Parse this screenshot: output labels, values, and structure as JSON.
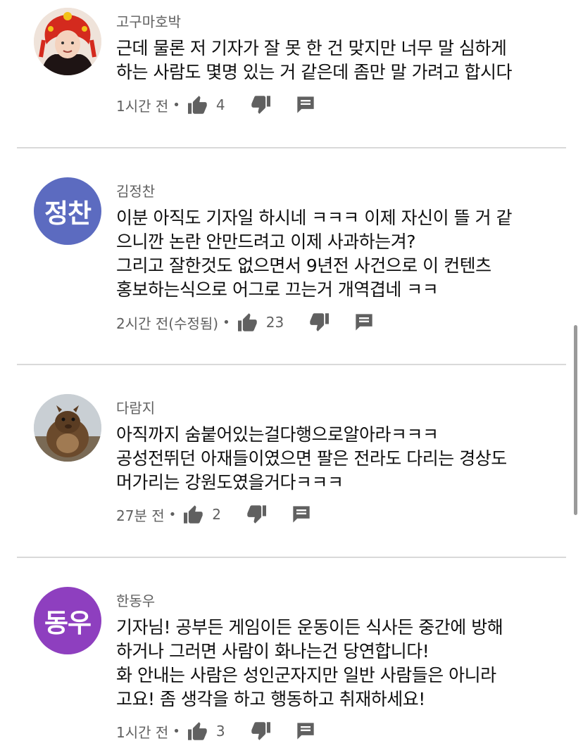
{
  "comments": [
    {
      "author": "고구마호박",
      "avatar_type": "photo-person-red-hat",
      "text": "근데 물론 저 기자가 잘 못 한 건 맞지만 너무 말 심하게\n하는 사람도 몇명 있는 거 같은데 좀만 말 가려고 합시다",
      "time": "1시간 전",
      "likes": "4"
    },
    {
      "author": "김정찬",
      "avatar_text": "정찬",
      "avatar_color": "#5c6bc0",
      "text": "이분 아직도 기자일 하시네 ㅋㅋㅋ 이제 자신이 뜰 거 같\n으니깐 논란 안만드려고 이제 사과하는겨?\n그리고 잘한것도 없으면서 9년전 사건으로 이 컨텐츠\n홍보하는식으로 어그로 끄는거 개역겹네 ㅋㅋ",
      "time": "2시간 전(수정됨)",
      "likes": "23"
    },
    {
      "author": "다람지",
      "avatar_type": "photo-squirrel",
      "text": "아직까지 숨붙어있는걸다행으로알아라ㅋㅋㅋ\n공성전뛰던 아재들이였으면 팔은 전라도 다리는 경상도\n머가리는 강원도였을거다ㅋㅋㅋ",
      "time": "27분 전",
      "likes": "2"
    },
    {
      "author": "한동우",
      "avatar_text": "동우",
      "avatar_color": "#8e3fbf",
      "text": "기자님! 공부든 게임이든 운동이든 식사든 중간에 방해\n하거나 그러면 사람이 화나는건 당연합니다!\n화 안내는 사람은 성인군자지만 일반 사람들은 아니라\n고요! 좀 생각을 하고 행동하고 취재하세요!",
      "time": "1시간 전",
      "likes": "3"
    }
  ],
  "icons": {
    "like": "thumbs-up-icon",
    "dislike": "thumbs-down-icon",
    "reply": "reply-comment-icon"
  }
}
